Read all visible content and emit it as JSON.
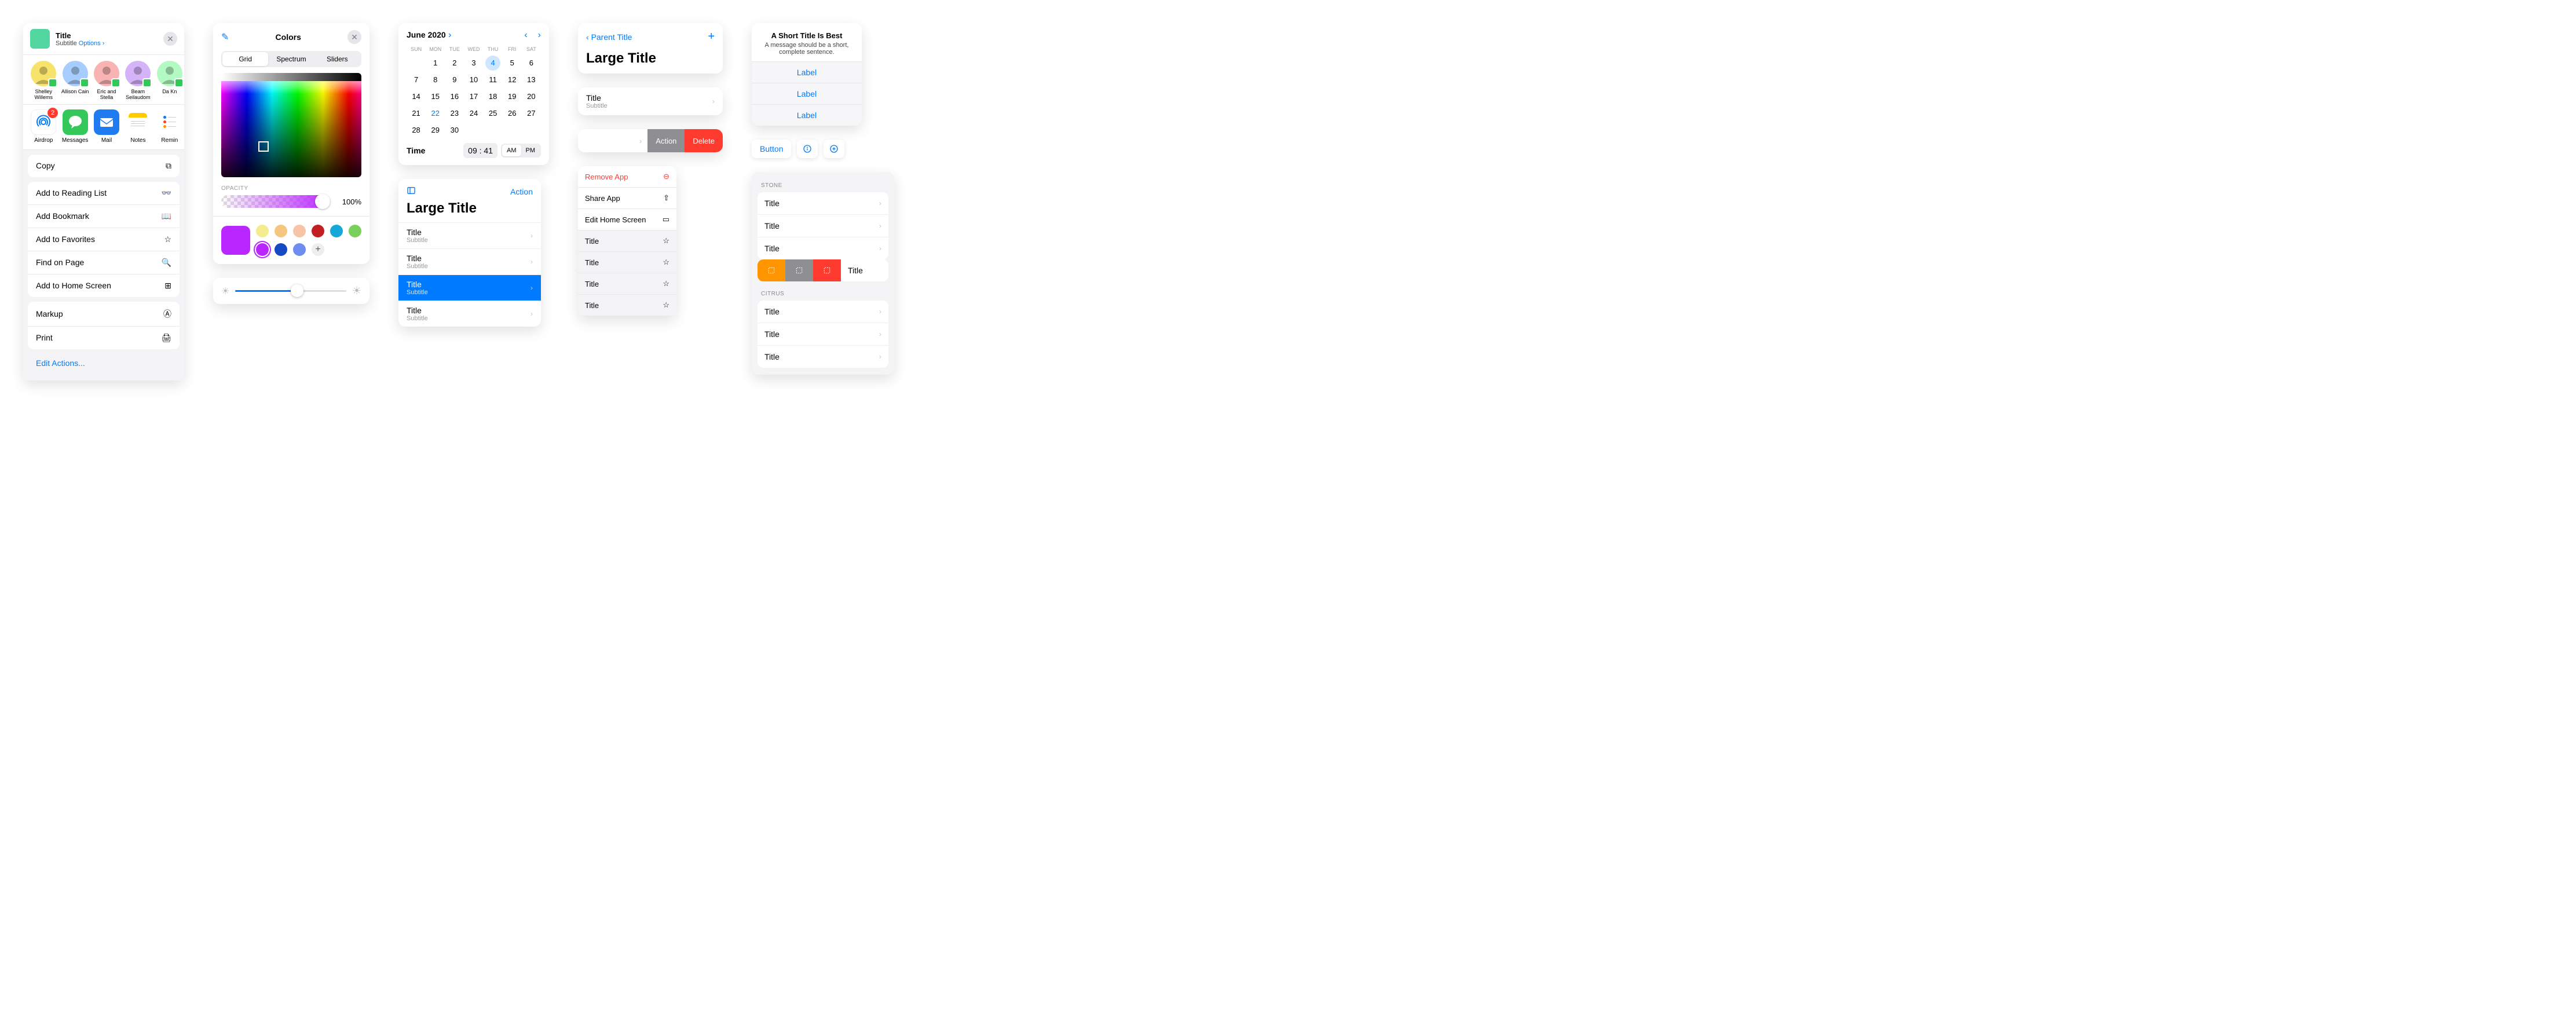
{
  "share": {
    "title": "Title",
    "subtitle": "Subtitle",
    "options": "Options",
    "people": [
      {
        "name": "Shelley Willems",
        "color": "#f7e36b"
      },
      {
        "name": "Allison Cain",
        "color": "#a6cdfd"
      },
      {
        "name": "Eric and Stella",
        "color": "#f9b3b3"
      },
      {
        "name": "Beam Seilaudom",
        "color": "#d5b3f9"
      },
      {
        "name": "Da Kn",
        "color": "#b3f9c4"
      }
    ],
    "apps": [
      {
        "name": "Airdrop",
        "badge": "2"
      },
      {
        "name": "Messages"
      },
      {
        "name": "Mail"
      },
      {
        "name": "Notes"
      },
      {
        "name": "Remin"
      }
    ],
    "copy": "Copy",
    "actions": [
      "Add to Reading List",
      "Add Bookmark",
      "Add to Favorites",
      "Find on Page",
      "Add to Home Screen"
    ],
    "actions2": [
      "Markup",
      "Print"
    ],
    "edit": "Edit Actions..."
  },
  "picker": {
    "title": "Colors",
    "tabs": [
      "Grid",
      "Spectrum",
      "Sliders"
    ],
    "opacity_label": "OPACITY",
    "opacity_value": "100%",
    "swatches": [
      "#f3ed8f",
      "#f5c77e",
      "#f8c4a8",
      "#c22020",
      "#18a7d9",
      "#7bcf5c",
      "#ba26ff",
      "#1649c4",
      "#6f8cf0"
    ]
  },
  "calendar": {
    "month": "June 2020",
    "dow": [
      "SUN",
      "MON",
      "TUE",
      "WED",
      "THU",
      "FRI",
      "SAT"
    ],
    "weeks": [
      [
        "",
        "1",
        "2",
        "3",
        "4",
        "5",
        "6"
      ],
      [
        "7",
        "8",
        "9",
        "10",
        "11",
        "12",
        "13"
      ],
      [
        "14",
        "15",
        "16",
        "17",
        "18",
        "19",
        "20"
      ],
      [
        "21",
        "22",
        "23",
        "24",
        "25",
        "26",
        "27"
      ],
      [
        "28",
        "29",
        "30",
        "",
        "",
        "",
        ""
      ]
    ],
    "today": "22",
    "selected": "4",
    "time_label": "Time",
    "hour": "09",
    "minute": "41",
    "am": "AM",
    "pm": "PM"
  },
  "ltl": {
    "action": "Action",
    "h1": "Large Title",
    "rows": [
      {
        "t": "Title",
        "s": "Subtitle"
      },
      {
        "t": "Title",
        "s": "Subtitle"
      },
      {
        "t": "Title",
        "s": "Subtitle",
        "sel": true
      },
      {
        "t": "Title",
        "s": "Subtitle"
      }
    ]
  },
  "navh": {
    "back": "Parent Title",
    "h1": "Large Title"
  },
  "navrow": {
    "t": "Title",
    "s": "Subtitle"
  },
  "swipe": {
    "action": "Action",
    "delete": "Delete"
  },
  "ctx": {
    "items": [
      {
        "t": "Remove App",
        "danger": true
      },
      {
        "t": "Share App"
      },
      {
        "t": "Edit Home Screen"
      },
      {
        "t": "Title",
        "gray": true
      },
      {
        "t": "Title",
        "gray": true
      },
      {
        "t": "Title",
        "gray": true
      },
      {
        "t": "Title",
        "gray": true
      }
    ]
  },
  "alert": {
    "title": "A Short Title Is Best",
    "message": "A message should be a short, complete sentence.",
    "buttons": [
      "Label",
      "Label",
      "Label"
    ]
  },
  "btnbar": {
    "button": "Button"
  },
  "glist": {
    "sec1": "STONE",
    "rows1": [
      "Title",
      "Title",
      "Title"
    ],
    "swipe_title": "Title",
    "swipe_colors": [
      "#ff9500",
      "#8e8e93",
      "#ff3b30"
    ],
    "sec2": "CITRUS",
    "rows2": [
      "Title",
      "Title",
      "Title"
    ]
  }
}
